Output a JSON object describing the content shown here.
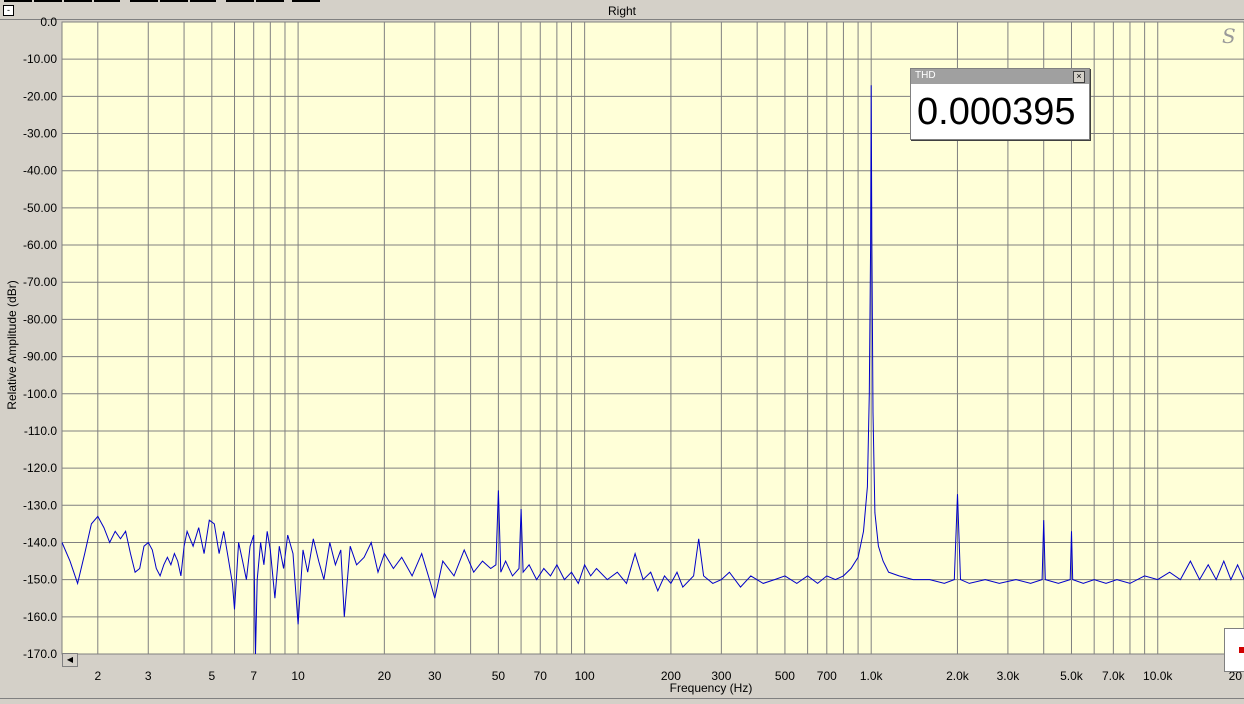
{
  "window": {
    "title": "Right",
    "collapse_glyph": "-"
  },
  "thd_panel": {
    "label": "THD",
    "value": "0.000395",
    "close_glyph": "×"
  },
  "watermark": "S",
  "colors": {
    "plot_bg": "#ffffd8",
    "grid": "#808080",
    "trace": "#0000c8",
    "frame": "#d4d0c8"
  },
  "icons": {
    "collapse": "minus-box-icon",
    "close": "close-x-icon",
    "scroll_left": "triangle-left-icon"
  },
  "chart_data": {
    "type": "line",
    "title": "Right",
    "xlabel": "Frequency (Hz)",
    "ylabel": "Relative Amplitude (dBr)",
    "xscale": "log",
    "xlim": [
      1.5,
      20000
    ],
    "ylim": [
      -170,
      0
    ],
    "grid": true,
    "y_ticks": [
      "0.0",
      "-10.00",
      "-20.00",
      "-30.00",
      "-40.00",
      "-50.00",
      "-60.00",
      "-70.00",
      "-80.00",
      "-90.00",
      "-100.0",
      "-110.0",
      "-120.0",
      "-130.0",
      "-140.0",
      "-150.0",
      "-160.0",
      "-170.0"
    ],
    "y_tick_values": [
      0,
      -10,
      -20,
      -30,
      -40,
      -50,
      -60,
      -70,
      -80,
      -90,
      -100,
      -110,
      -120,
      -130,
      -140,
      -150,
      -160,
      -170
    ],
    "x_ticks": [
      {
        "v": 2,
        "t": "2"
      },
      {
        "v": 3,
        "t": "3"
      },
      {
        "v": 5,
        "t": "5"
      },
      {
        "v": 7,
        "t": "7"
      },
      {
        "v": 10,
        "t": "10"
      },
      {
        "v": 20,
        "t": "20"
      },
      {
        "v": 30,
        "t": "30"
      },
      {
        "v": 50,
        "t": "50"
      },
      {
        "v": 70,
        "t": "70"
      },
      {
        "v": 100,
        "t": "100"
      },
      {
        "v": 200,
        "t": "200"
      },
      {
        "v": 300,
        "t": "300"
      },
      {
        "v": 500,
        "t": "500"
      },
      {
        "v": 700,
        "t": "700"
      },
      {
        "v": 1000,
        "t": "1.0k"
      },
      {
        "v": 2000,
        "t": "2.0k"
      },
      {
        "v": 3000,
        "t": "3.0k"
      },
      {
        "v": 5000,
        "t": "5.0k"
      },
      {
        "v": 7000,
        "t": "7.0k"
      },
      {
        "v": 10000,
        "t": "10.0k"
      },
      {
        "v": 20000,
        "t": "20"
      }
    ],
    "series": [
      {
        "points": [
          [
            1.5,
            -140
          ],
          [
            1.6,
            -145
          ],
          [
            1.7,
            -151
          ],
          [
            1.8,
            -143
          ],
          [
            1.9,
            -135
          ],
          [
            2.0,
            -133
          ],
          [
            2.1,
            -136
          ],
          [
            2.2,
            -140
          ],
          [
            2.3,
            -137
          ],
          [
            2.4,
            -139
          ],
          [
            2.5,
            -137
          ],
          [
            2.6,
            -143
          ],
          [
            2.7,
            -148
          ],
          [
            2.8,
            -147
          ],
          [
            2.9,
            -141
          ],
          [
            3.0,
            -140
          ],
          [
            3.1,
            -142
          ],
          [
            3.2,
            -147
          ],
          [
            3.3,
            -149
          ],
          [
            3.4,
            -146
          ],
          [
            3.5,
            -144
          ],
          [
            3.6,
            -146
          ],
          [
            3.7,
            -143
          ],
          [
            3.8,
            -145
          ],
          [
            3.9,
            -149
          ],
          [
            4.0,
            -141
          ],
          [
            4.1,
            -137
          ],
          [
            4.3,
            -141
          ],
          [
            4.5,
            -136
          ],
          [
            4.7,
            -143
          ],
          [
            4.9,
            -134
          ],
          [
            5.1,
            -135
          ],
          [
            5.3,
            -143
          ],
          [
            5.5,
            -137
          ],
          [
            5.7,
            -144
          ],
          [
            5.9,
            -151
          ],
          [
            6.0,
            -158
          ],
          [
            6.2,
            -140
          ],
          [
            6.4,
            -145
          ],
          [
            6.6,
            -150
          ],
          [
            6.8,
            -141
          ],
          [
            7.0,
            -138
          ],
          [
            7.1,
            -170
          ],
          [
            7.2,
            -150
          ],
          [
            7.4,
            -140
          ],
          [
            7.6,
            -146
          ],
          [
            7.8,
            -137
          ],
          [
            8.0,
            -142
          ],
          [
            8.3,
            -155
          ],
          [
            8.6,
            -141
          ],
          [
            8.9,
            -147
          ],
          [
            9.2,
            -138
          ],
          [
            9.6,
            -143
          ],
          [
            10.0,
            -162
          ],
          [
            10.4,
            -142
          ],
          [
            10.8,
            -148
          ],
          [
            11.3,
            -139
          ],
          [
            11.8,
            -145
          ],
          [
            12.3,
            -150
          ],
          [
            12.9,
            -140
          ],
          [
            13.5,
            -146
          ],
          [
            14.1,
            -142
          ],
          [
            14.5,
            -160
          ],
          [
            15.2,
            -141
          ],
          [
            16,
            -146
          ],
          [
            17,
            -144
          ],
          [
            18,
            -140
          ],
          [
            19,
            -148
          ],
          [
            20,
            -143
          ],
          [
            21.5,
            -147
          ],
          [
            23,
            -144
          ],
          [
            25,
            -149
          ],
          [
            27,
            -143
          ],
          [
            29,
            -151
          ],
          [
            30,
            -155
          ],
          [
            32,
            -145
          ],
          [
            35,
            -149
          ],
          [
            38,
            -142
          ],
          [
            41,
            -148
          ],
          [
            44,
            -145
          ],
          [
            47,
            -147
          ],
          [
            49,
            -146
          ],
          [
            50,
            -126
          ],
          [
            51,
            -148
          ],
          [
            53,
            -145
          ],
          [
            56,
            -149
          ],
          [
            59,
            -147
          ],
          [
            60,
            -131
          ],
          [
            61,
            -148
          ],
          [
            64,
            -146
          ],
          [
            68,
            -150
          ],
          [
            72,
            -147
          ],
          [
            76,
            -149
          ],
          [
            80,
            -146
          ],
          [
            85,
            -150
          ],
          [
            90,
            -148
          ],
          [
            95,
            -151
          ],
          [
            100,
            -146
          ],
          [
            105,
            -149
          ],
          [
            110,
            -147
          ],
          [
            120,
            -150
          ],
          [
            130,
            -148
          ],
          [
            140,
            -151
          ],
          [
            150,
            -143
          ],
          [
            160,
            -150
          ],
          [
            170,
            -148
          ],
          [
            180,
            -153
          ],
          [
            190,
            -149
          ],
          [
            200,
            -151
          ],
          [
            210,
            -148
          ],
          [
            220,
            -152
          ],
          [
            240,
            -149
          ],
          [
            250,
            -139
          ],
          [
            260,
            -149
          ],
          [
            280,
            -151
          ],
          [
            300,
            -150
          ],
          [
            320,
            -148
          ],
          [
            350,
            -152
          ],
          [
            380,
            -149
          ],
          [
            420,
            -151
          ],
          [
            460,
            -150
          ],
          [
            500,
            -149
          ],
          [
            550,
            -151
          ],
          [
            600,
            -149
          ],
          [
            650,
            -151
          ],
          [
            700,
            -149
          ],
          [
            750,
            -150
          ],
          [
            800,
            -149
          ],
          [
            850,
            -147
          ],
          [
            900,
            -144
          ],
          [
            940,
            -137
          ],
          [
            970,
            -125
          ],
          [
            985,
            -100
          ],
          [
            995,
            -60
          ],
          [
            1000,
            -17
          ],
          [
            1005,
            -57
          ],
          [
            1015,
            -105
          ],
          [
            1030,
            -132
          ],
          [
            1060,
            -141
          ],
          [
            1100,
            -145
          ],
          [
            1150,
            -148
          ],
          [
            1250,
            -149
          ],
          [
            1400,
            -150
          ],
          [
            1600,
            -150
          ],
          [
            1800,
            -151
          ],
          [
            1950,
            -150
          ],
          [
            2000,
            -127
          ],
          [
            2050,
            -150
          ],
          [
            2200,
            -151
          ],
          [
            2500,
            -150
          ],
          [
            2800,
            -151
          ],
          [
            3200,
            -150
          ],
          [
            3600,
            -151
          ],
          [
            3950,
            -150
          ],
          [
            4000,
            -134
          ],
          [
            4050,
            -150
          ],
          [
            4500,
            -151
          ],
          [
            4950,
            -150
          ],
          [
            5000,
            -137
          ],
          [
            5050,
            -150
          ],
          [
            5500,
            -151
          ],
          [
            6000,
            -150
          ],
          [
            6600,
            -151
          ],
          [
            7200,
            -150
          ],
          [
            8000,
            -151
          ],
          [
            9000,
            -149
          ],
          [
            10000,
            -150
          ],
          [
            11000,
            -148
          ],
          [
            12000,
            -150
          ],
          [
            13000,
            -145
          ],
          [
            14000,
            -150
          ],
          [
            15000,
            -146
          ],
          [
            16000,
            -150
          ],
          [
            17000,
            -145
          ],
          [
            18000,
            -150
          ],
          [
            19000,
            -146
          ],
          [
            20000,
            -150
          ]
        ]
      }
    ]
  }
}
